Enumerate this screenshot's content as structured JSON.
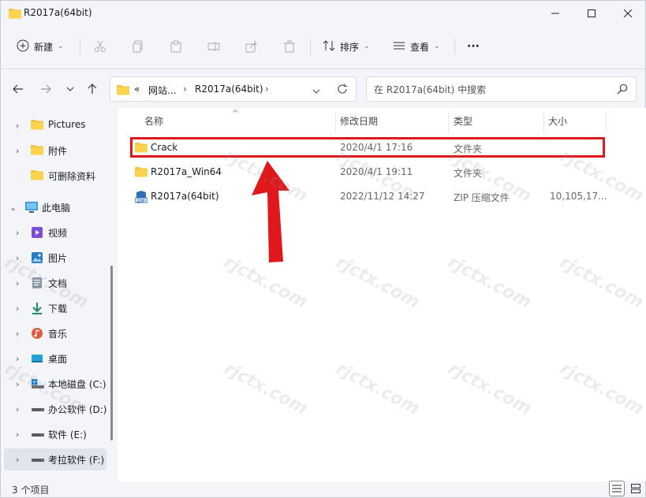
{
  "window": {
    "title": "R2017a(64bit)"
  },
  "toolbar": {
    "new_label": "新建",
    "sort_label": "排序",
    "view_label": "查看",
    "more_label": "···"
  },
  "address": {
    "overflow": "«",
    "segment1": "网站...",
    "separator1": "›",
    "segment2": "R2017a(64bit)",
    "separator2": "›"
  },
  "search": {
    "placeholder": "在 R2017a(64bit) 中搜索"
  },
  "sidebar": {
    "items": [
      {
        "label": "Pictures",
        "icon": "folder-icon"
      },
      {
        "label": "附件",
        "icon": "folder-icon"
      },
      {
        "label": "可删除资料",
        "icon": "folder-icon"
      },
      {
        "label": "此电脑",
        "icon": "computer-icon"
      },
      {
        "label": "视频",
        "icon": "video-icon"
      },
      {
        "label": "图片",
        "icon": "pictures-icon"
      },
      {
        "label": "文档",
        "icon": "documents-icon"
      },
      {
        "label": "下载",
        "icon": "download-icon"
      },
      {
        "label": "音乐",
        "icon": "music-icon"
      },
      {
        "label": "桌面",
        "icon": "desktop-icon"
      },
      {
        "label": "本地磁盘 (C:)",
        "icon": "drive-icon"
      },
      {
        "label": "办公软件 (D:)",
        "icon": "drive-icon"
      },
      {
        "label": "软件 (E:)",
        "icon": "drive-icon"
      },
      {
        "label": "考拉软件 (F:)",
        "icon": "drive-icon"
      }
    ]
  },
  "columns": {
    "name": "名称",
    "modified": "修改日期",
    "type": "类型",
    "size": "大小"
  },
  "files": [
    {
      "name": "Crack",
      "modified": "2020/4/1 17:16",
      "type": "文件夹",
      "size": "",
      "icon": "folder-icon"
    },
    {
      "name": "R2017a_Win64",
      "modified": "2020/4/1 19:11",
      "type": "文件夹",
      "size": "",
      "icon": "folder-icon"
    },
    {
      "name": "R2017a(64bit)",
      "modified": "2022/11/12 14:27",
      "type": "ZIP 压缩文件",
      "size": "10,105,17...",
      "icon": "zip-icon"
    }
  ],
  "status": {
    "item_count": "3 个项目"
  },
  "watermark": "rjctx.com",
  "colors": {
    "highlight": "#e0171b",
    "arrow": "#e0171b",
    "folder": "#f5c542"
  }
}
